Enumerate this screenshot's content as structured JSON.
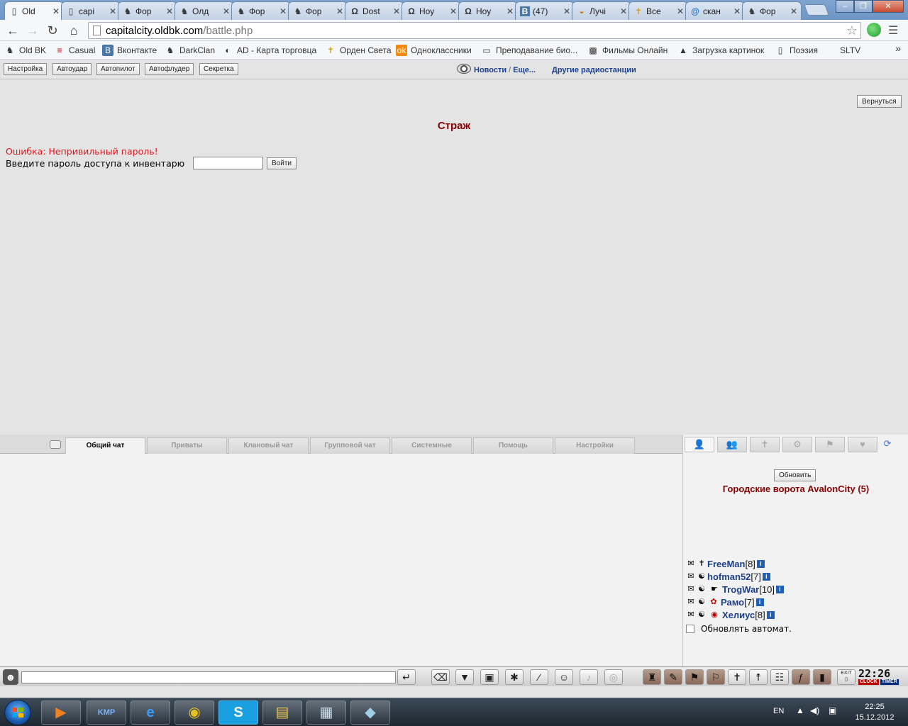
{
  "browser": {
    "tabs": [
      {
        "label": "Old",
        "icon": "page-icon",
        "active": true
      },
      {
        "label": "capi",
        "icon": "page-icon"
      },
      {
        "label": "Фор",
        "icon": "bk-icon"
      },
      {
        "label": "Олд",
        "icon": "bk-icon"
      },
      {
        "label": "Фор",
        "icon": "bk-icon"
      },
      {
        "label": "Фор",
        "icon": "bk-icon"
      },
      {
        "label": "Dost",
        "icon": "omega-icon"
      },
      {
        "label": "Ноу",
        "icon": "omega-icon"
      },
      {
        "label": "Ноу",
        "icon": "omega-icon"
      },
      {
        "label": "(47)",
        "icon": "vk-icon"
      },
      {
        "label": "Лучі",
        "icon": "bowl-icon"
      },
      {
        "label": "Все",
        "icon": "cross-icon"
      },
      {
        "label": "скан",
        "icon": "at-icon"
      },
      {
        "label": "Фор",
        "icon": "bk-icon"
      }
    ],
    "url_host": "capitalcity.oldbk.com",
    "url_path": "/battle.php",
    "bookmarks": [
      {
        "label": "Old BK",
        "icon": "bk-icon"
      },
      {
        "label": "Casual",
        "icon": "flag-icon"
      },
      {
        "label": "Вконтакте",
        "icon": "vk-icon"
      },
      {
        "label": "DarkClan",
        "icon": "bk-icon"
      },
      {
        "label": "AD - Карта торговца",
        "icon": "ad-icon"
      },
      {
        "label": "Орден Света",
        "icon": "cross-icon"
      },
      {
        "label": "Одноклассники",
        "icon": "ok-icon"
      },
      {
        "label": "Преподавание био...",
        "icon": "board-icon"
      },
      {
        "label": "Фильмы Онлайн",
        "icon": "film-icon"
      },
      {
        "label": "Загрузка картинок",
        "icon": "image-icon"
      },
      {
        "label": "Поэзия",
        "icon": "page-icon"
      },
      {
        "label": "SLTV",
        "icon": ""
      }
    ],
    "more_bookmarks": "»"
  },
  "topbar": {
    "buttons": [
      "Настройка",
      "Автоудар",
      "Автопилот",
      "Автофлудер",
      "Секретка"
    ],
    "radio_news": "Новости",
    "radio_sep": "/",
    "radio_more": "Еще...",
    "other_stations": "Другие радиостанции"
  },
  "main": {
    "back_button": "Вернуться",
    "title": "Страж",
    "error": "Ошибка: Непривильный пароль!",
    "prompt": "Введите пароль доступа к инвентарю",
    "password_value": "",
    "login_button": "Войти"
  },
  "chat": {
    "tabs": [
      "Общий чат",
      "Приваты",
      "Клановый чат",
      "Групповой чат",
      "Системные",
      "Помощь",
      "Настройки"
    ],
    "active_tab": 0,
    "input_value": ""
  },
  "side": {
    "refresh_button": "Обновить",
    "location": "Городские ворота AvalonCity (5)",
    "players": [
      {
        "name": "FreeMan",
        "level": "[8]"
      },
      {
        "name": "hofman52",
        "level": "[7]"
      },
      {
        "name": "TrogWar",
        "level": "[10]"
      },
      {
        "name": "Рамо",
        "level": "[7]"
      },
      {
        "name": "Хелиус",
        "level": "[8]"
      }
    ],
    "info_glyph": "i",
    "auto_refresh_label": "Обновлять автомат.",
    "auto_refresh_checked": false
  },
  "clock": {
    "time": "22:26",
    "label_clock": "CLOCK",
    "label_timer": "TIMER",
    "exit_label": "EXIT"
  },
  "taskbar": {
    "lang": "EN",
    "time": "22:25",
    "date": "15.12.2012"
  },
  "colors": {
    "accent_title": "#8b0000",
    "error": "#e0161b",
    "player_name": "#1b3f8c"
  }
}
